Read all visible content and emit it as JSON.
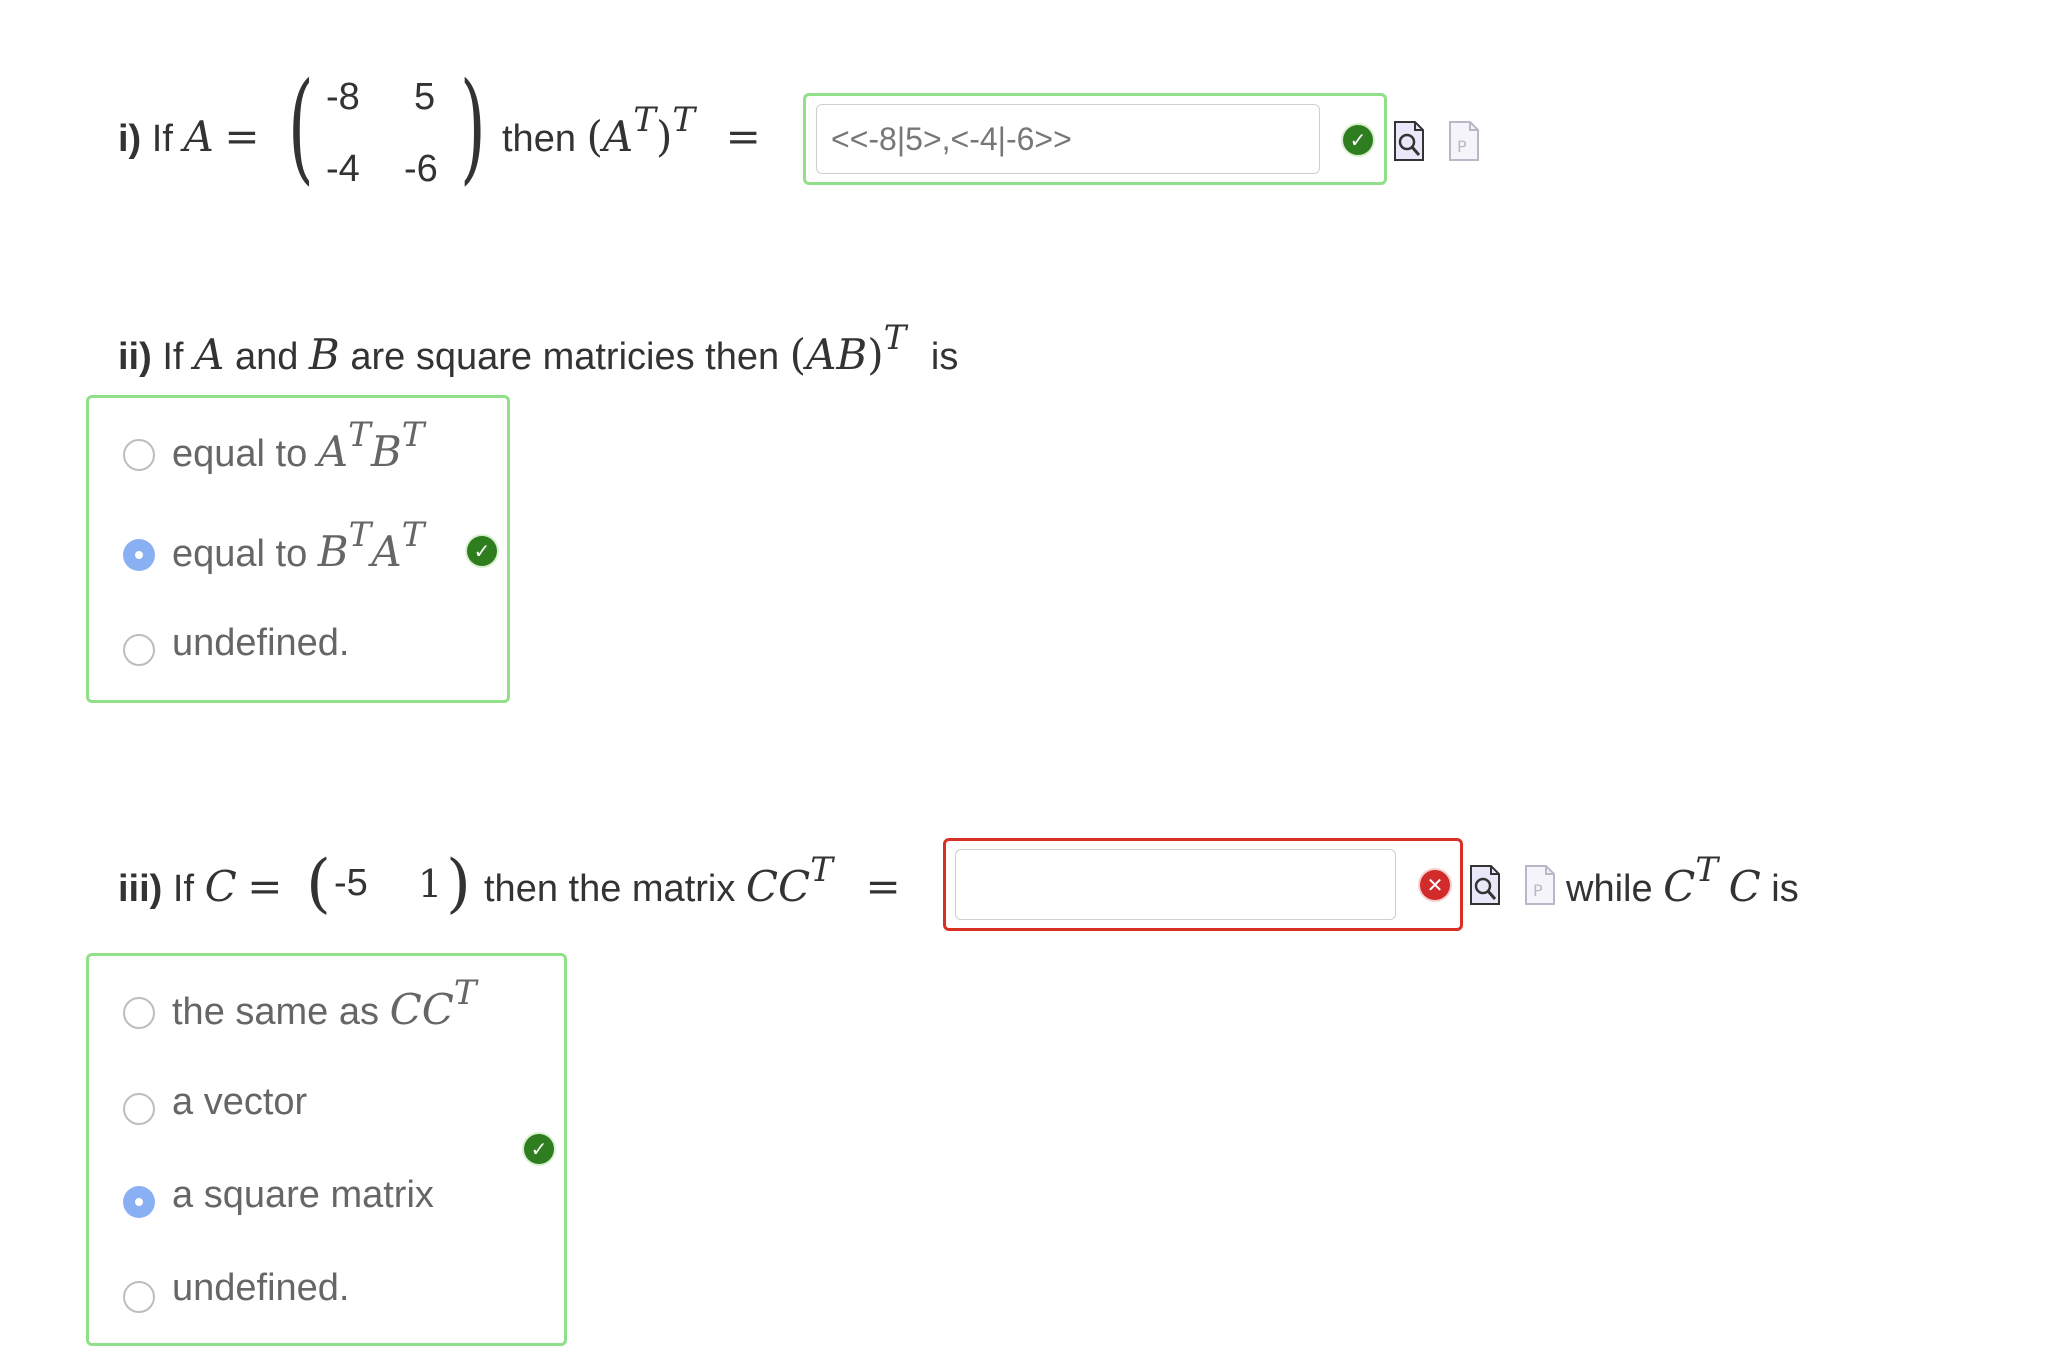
{
  "q1": {
    "label": "i)",
    "pre": "If",
    "A": "A",
    "eq": "=",
    "matrix": [
      [
        "-8",
        "5"
      ],
      [
        "-4",
        "-6"
      ]
    ],
    "then": "then",
    "expr_open": "(A",
    "expr_sup1": "T",
    "expr_close": ")",
    "expr_sup2": "T",
    "eq2": "=",
    "answer_value": "<<-8|5>,<-4|-6>>",
    "status": "correct"
  },
  "q2": {
    "label": "ii)",
    "pre": "If",
    "A": "A",
    "and": "and",
    "B": "B",
    "mid": "are square matricies then",
    "expr": "(AB)",
    "expr_sup": "T",
    "post": "is",
    "options": [
      {
        "text": "equal to",
        "math_a": "A",
        "sup_a": "T",
        "math_b": "B",
        "sup_b": "T",
        "selected": false
      },
      {
        "text": "equal to",
        "math_a": "B",
        "sup_a": "T",
        "math_b": "A",
        "sup_b": "T",
        "selected": true
      },
      {
        "text": "undefined.",
        "selected": false
      }
    ],
    "status": "correct"
  },
  "q3": {
    "label": "iii)",
    "pre": "If",
    "C": "C",
    "eq": "=",
    "row": [
      "-5",
      "1"
    ],
    "mid": "then the matrix",
    "expr": "CC",
    "expr_sup": "T",
    "eq2": "=",
    "answer_value": "",
    "status": "incorrect",
    "while": "while",
    "expr2_a": "C",
    "expr2_sup": "T",
    "expr2_b": "C",
    "is": "is",
    "options": [
      {
        "text": "the same as",
        "math": "CC",
        "sup": "T",
        "selected": false
      },
      {
        "text": "a vector",
        "selected": false
      },
      {
        "text": "a square matrix",
        "selected": true
      },
      {
        "text": "undefined.",
        "selected": false
      }
    ],
    "mc_status": "correct"
  },
  "icons": {
    "check": "check-icon",
    "cross": "cross-icon",
    "preview": "preview-icon",
    "pdf": "pdf-icon"
  },
  "colors": {
    "correct_border": "#90e08a",
    "incorrect_border": "#d93025",
    "check_green": "#2e7d1f",
    "cross_red": "#d22b2b",
    "radio_selected": "#8ab0f4"
  }
}
